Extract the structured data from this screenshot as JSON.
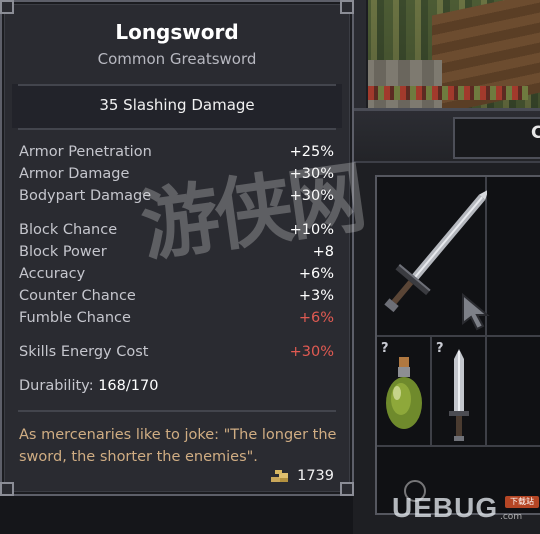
{
  "tooltip": {
    "title": "Longsword",
    "subtitle": "Common Greatsword",
    "damage": "35 Slashing Damage",
    "group1": [
      {
        "label": "Armor Penetration",
        "value": "+25%",
        "negative": false
      },
      {
        "label": "Armor Damage",
        "value": "+30%",
        "negative": false
      },
      {
        "label": "Bodypart Damage",
        "value": "+30%",
        "negative": false
      }
    ],
    "group2": [
      {
        "label": "Block Chance",
        "value": "+10%",
        "negative": false
      },
      {
        "label": "Block Power",
        "value": "+8",
        "negative": false
      },
      {
        "label": "Accuracy",
        "value": "+6%",
        "negative": false
      },
      {
        "label": "Counter Chance",
        "value": "+3%",
        "negative": false
      },
      {
        "label": "Fumble Chance",
        "value": "+6%",
        "negative": true
      }
    ],
    "group3": [
      {
        "label": "Skills Energy Cost",
        "value": "+30%",
        "negative": true
      }
    ],
    "durability_label": "Durability:",
    "durability_value": "168/170",
    "flavor": "As mercenaries like to joke: \"The longer the sword, the shorter the enemies\".",
    "price": "1739",
    "price_icon": "coins-icon"
  },
  "inventory": {
    "header_letter": "C",
    "unknown_marks": [
      "?",
      "?"
    ],
    "items": [
      "longsword",
      "potion",
      "dagger"
    ]
  },
  "watermark": {
    "big": "游侠网",
    "logo": "UEBUG",
    "domain": ".com",
    "badge": "下载站"
  },
  "colors": {
    "panel_bg": "#2a2b31",
    "value_positive": "#ffffff",
    "value_negative": "#e05a52",
    "flavor": "#d0ad83"
  }
}
